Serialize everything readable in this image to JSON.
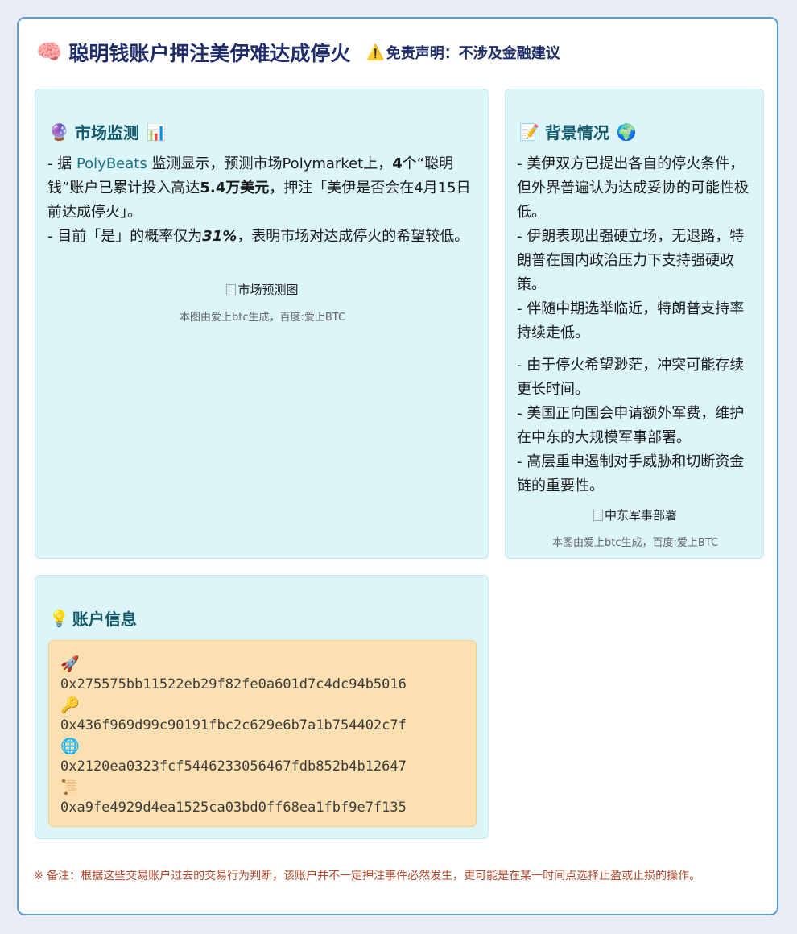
{
  "header": {
    "icon": "brain-icon",
    "title": "聪明钱账户押注美伊难达成停火",
    "disclaimer_icon": "warning-icon",
    "disclaimer": "免责声明：不涉及金融建议"
  },
  "market_panel": {
    "title": "市场监测",
    "icon_left": "crystal-ball-icon",
    "icon_right": "bar-chart-icon",
    "p1_prefix": "- 据",
    "p1_link": "PolyBeats",
    "p1_mid": "监测显示，预测市场Polymarket上，",
    "p1_count": "4",
    "p1_mid2": "个“聪明钱”账户已累计投入高达",
    "p1_amount": "5.4万美元",
    "p1_suffix": "，押注「美伊是否会在4月15日前达成停火」。",
    "p2_prefix": "- 目前「是」的概率仅为",
    "p2_prob": "31%",
    "p2_suffix": "，表明市场对达成停火的希望较低。",
    "image_alt": "市场预测图",
    "caption": "本图由爱上btc生成，百度:爱上BTC"
  },
  "background_panel": {
    "title": "背景情况",
    "icon_left": "memo-icon",
    "icon_right": "globe-icon",
    "para1": [
      "- 美伊双方已提出各自的停火条件，但外界普遍认为达成妥协的可能性极低。",
      "- 伊朗表现出强硬立场，无退路，特朗普在国内政治压力下支持强硬政策。",
      "- 伴随中期选举临近，特朗普支持率持续走低。"
    ],
    "para2": [
      "- 由于停火希望渺茫，冲突可能存续更长时间。",
      "- 美国正向国会申请额外军费，维护在中东的大规模军事部署。",
      "- 高层重申遏制对手威胁和切断资金链的重要性。"
    ],
    "image_alt": "中东军事部署",
    "caption": "本图由爱上btc生成，百度:爱上BTC"
  },
  "accounts_panel": {
    "title": "账户信息",
    "icon": "lightbulb-icon",
    "accounts": [
      {
        "icon": "rocket-icon",
        "address": "0x275575bb11522eb29f82fe0a601d7c4dc94b5016"
      },
      {
        "icon": "key-icon",
        "address": "0x436f969d99c90191fbc2c629e6b7a1b754402c7f"
      },
      {
        "icon": "globe-meridians-icon",
        "address": "0x2120ea0323fcf5446233056467fdb852b4b12647"
      },
      {
        "icon": "scroll-icon",
        "address": "0xa9fe4929d4ea1525ca03bd0ff68ea1fbf9e7f135"
      }
    ]
  },
  "note": "※ 备注：根据这些交易账户过去的交易行为判断，该账户并不一定押注事件必然发生，更可能是在某一时间点选择止盈或止损的操作。"
}
